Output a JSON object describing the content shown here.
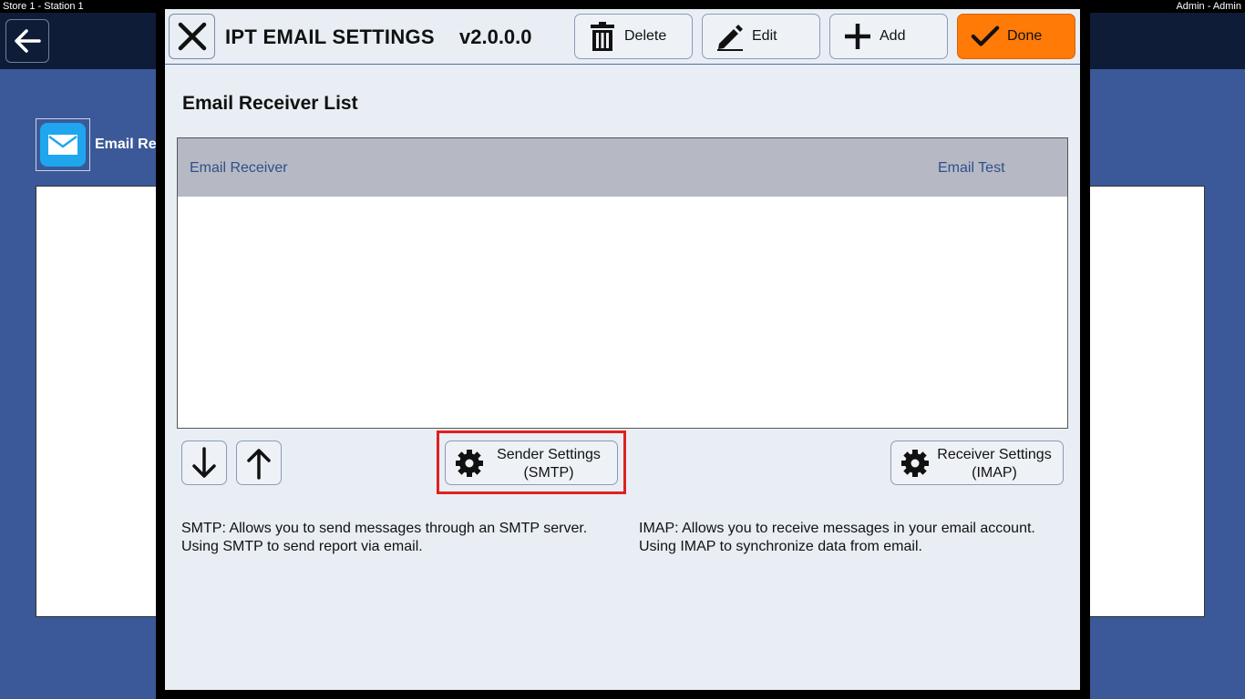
{
  "system_bar": {
    "left_text": "Store 1 - Station 1",
    "right_text": "Admin - Admin"
  },
  "background": {
    "title": "Email Re"
  },
  "dialog": {
    "title": "IPT EMAIL SETTINGS",
    "version": "v2.0.0.0",
    "toolbar": {
      "delete_label": "Delete",
      "edit_label": "Edit",
      "add_label": "Add",
      "done_label": "Done"
    },
    "section_title": "Email Receiver List",
    "list": {
      "columns": [
        "Email Receiver",
        "Email Test"
      ],
      "rows": []
    },
    "sender_button": {
      "line1": "Sender Settings",
      "line2": "(SMTP)"
    },
    "receiver_button": {
      "line1": "Receiver Settings",
      "line2": "(IMAP)"
    },
    "smtp_description": "SMTP: Allows you to send messages through an SMTP server. Using SMTP to send report via email.",
    "imap_description": "IMAP: Allows you to receive messages in your email account. Using IMAP to synchronize data from email."
  },
  "colors": {
    "done_button": "#ff7a07",
    "background_main": "#3b5998",
    "highlight": "#e02020"
  }
}
